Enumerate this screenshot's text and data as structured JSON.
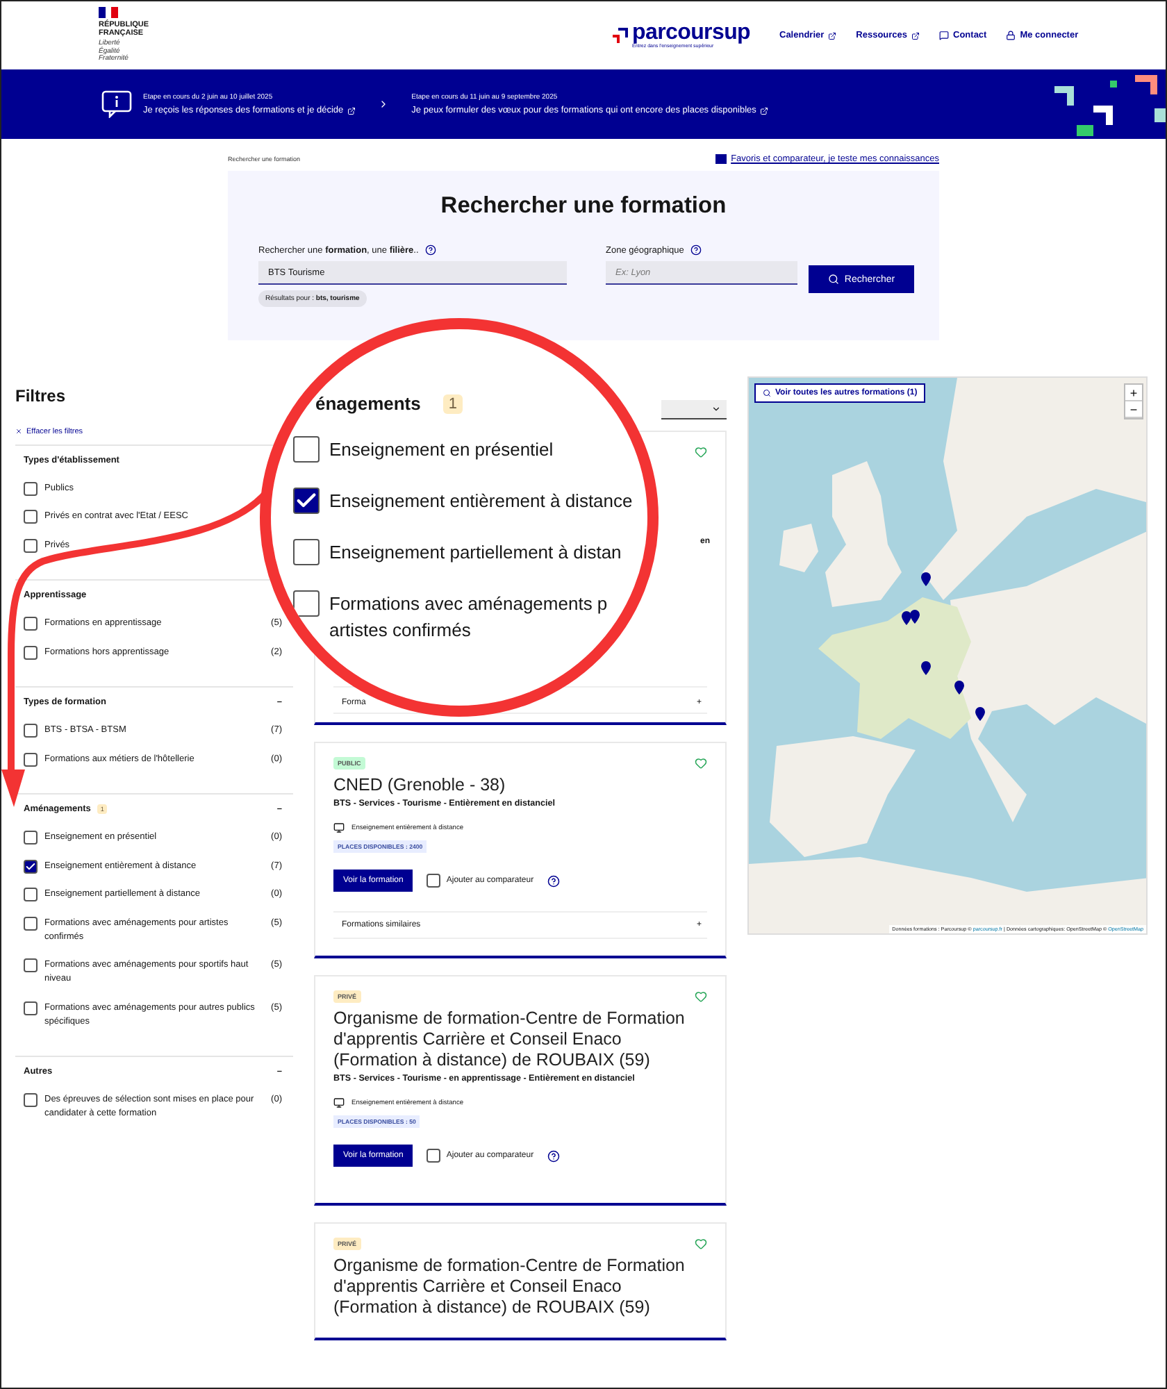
{
  "header": {
    "gov_lines": [
      "RÉPUBLIQUE",
      "FRANÇAISE"
    ],
    "motto_lines": [
      "Liberté",
      "Égalité",
      "Fraternité"
    ],
    "brand": "parcoursup",
    "tagline": "Entrez dans l'enseignement supérieur",
    "nav": [
      {
        "label": "Calendrier",
        "kind": "external"
      },
      {
        "label": "Ressources",
        "kind": "external"
      },
      {
        "label": "Contact",
        "kind": "contact"
      },
      {
        "label": "Me connecter",
        "kind": "login"
      }
    ]
  },
  "banner": {
    "steps": [
      {
        "dates": "Etape en cours du 2 juin au 10 juillet 2025",
        "text": "Je reçois les réponses des formations et je décide"
      },
      {
        "dates": "Etape en cours du 11 juin au 9 septembre 2025",
        "text": "Je peux formuler des vœux pour des formations qui ont encore des places disponibles"
      }
    ]
  },
  "breadcrumb": "Rechercher une formation",
  "help_link": "Favoris et comparateur, je teste mes connaissances",
  "search": {
    "title": "Rechercher une formation",
    "formation_label": "Rechercher une **formation**, une **filière**..",
    "formation_value": "BTS Tourisme",
    "zone_label": "Zone géographique",
    "zone_placeholder": "Ex: Lyon",
    "button": "Rechercher",
    "results_chip": "Résultats pour : **bts, tourisme**"
  },
  "filters": {
    "title": "Filtres",
    "clear": "Effacer les filtres",
    "groups": [
      {
        "title": "Types d'établissement",
        "options": [
          {
            "label": "Publics",
            "checked": false
          },
          {
            "label": "Privés en contrat avec l'Etat / EESC",
            "checked": false
          },
          {
            "label": "Privés",
            "checked": false
          }
        ]
      },
      {
        "title": "Apprentissage",
        "options": [
          {
            "label": "Formations en apprentissage",
            "count": "(5)",
            "checked": false
          },
          {
            "label": "Formations hors apprentissage",
            "count": "(2)",
            "checked": false
          }
        ]
      },
      {
        "title": "Types de formation",
        "toggle": "–",
        "options": [
          {
            "label": "BTS - BTSA - BTSM",
            "count": "(7)",
            "checked": false
          },
          {
            "label": "Formations aux métiers de l'hôtellerie",
            "count": "(0)",
            "checked": false
          }
        ]
      },
      {
        "title": "Aménagements",
        "badge": "1",
        "toggle": "–",
        "options": [
          {
            "label": "Enseignement en présentiel",
            "count": "(0)",
            "checked": false
          },
          {
            "label": "Enseignement entièrement à distance",
            "count": "(7)",
            "checked": true
          },
          {
            "label": "Enseignement partiellement à distance",
            "count": "(0)",
            "checked": false
          },
          {
            "label": "Formations avec aménagements pour artistes confirmés",
            "count": "(5)",
            "checked": false
          },
          {
            "label": "Formations avec aménagements pour sportifs haut niveau",
            "count": "(5)",
            "checked": false
          },
          {
            "label": "Formations avec aménagements pour autres publics spécifiques",
            "count": "(5)",
            "checked": false
          }
        ]
      },
      {
        "title": "Autres",
        "toggle": "–",
        "options": [
          {
            "label": "Des épreuves de sélection sont mises en place pour candidater à cette formation",
            "count": "(0)",
            "checked": false
          }
        ]
      }
    ]
  },
  "magnifier": {
    "heading": "énagements",
    "badge": "1",
    "options": [
      {
        "label": "Enseignement en présentiel",
        "checked": false
      },
      {
        "label": "Enseignement entièrement à distance",
        "checked": true
      },
      {
        "label": "Enseignement partiellement à distan",
        "checked": false
      },
      {
        "label": "Formations avec aménagements p",
        "label_2": "artistes confirmés",
        "checked": false
      }
    ]
  },
  "results": [
    {
      "kind": "covered",
      "fragment": "en",
      "similar": "Forma",
      "expand": "+"
    },
    {
      "kind": "full",
      "status": "PUBLIC",
      "color": "#c3fad5",
      "title": "CNED (Grenoble - 38)",
      "subtitle": "BTS - Services - Tourisme - Entièrement en distanciel",
      "mode": "Enseignement entièrement à distance",
      "places": "PLACES DISPONIBLES : 2400",
      "button": "Voir la formation",
      "compare": "Ajouter au comparateur",
      "compare_checked": false,
      "similar": "Formations similaires",
      "expand": "+"
    },
    {
      "kind": "full",
      "status": "PRIVÉ",
      "color": "#feecc2",
      "title": "Organisme de formation-Centre de Formation d'apprentis Carrière et Conseil Enaco (Formation à distance) de ROUBAIX (59)",
      "subtitle": "BTS - Services - Tourisme - en apprentissage - Entièrement en distanciel",
      "mode": "Enseignement entièrement à distance",
      "places": "PLACES DISPONIBLES : 50",
      "button": "Voir la formation",
      "compare": "Ajouter au comparateur",
      "compare_checked": false
    },
    {
      "kind": "full",
      "status": "PRIVÉ",
      "color": "#feecc2",
      "title": "Organisme de formation-Centre de Formation d'apprentis Carrière et Conseil Enaco (Formation à distance) de ROUBAIX (59)"
    }
  ],
  "map": {
    "button": "Voir toutes les autres formations (1)",
    "zoom_in": "+",
    "zoom_out": "−",
    "attribution": [
      {
        "text": "Données formations : Parcoursup © ",
        "kind": "text"
      },
      {
        "text": "parcoursup.fr",
        "kind": "link"
      },
      {
        "text": " | Données cartographiques: OpenStreetMap © ",
        "kind": "text"
      },
      {
        "text": "OpenStreetMap",
        "kind": "link"
      }
    ]
  }
}
